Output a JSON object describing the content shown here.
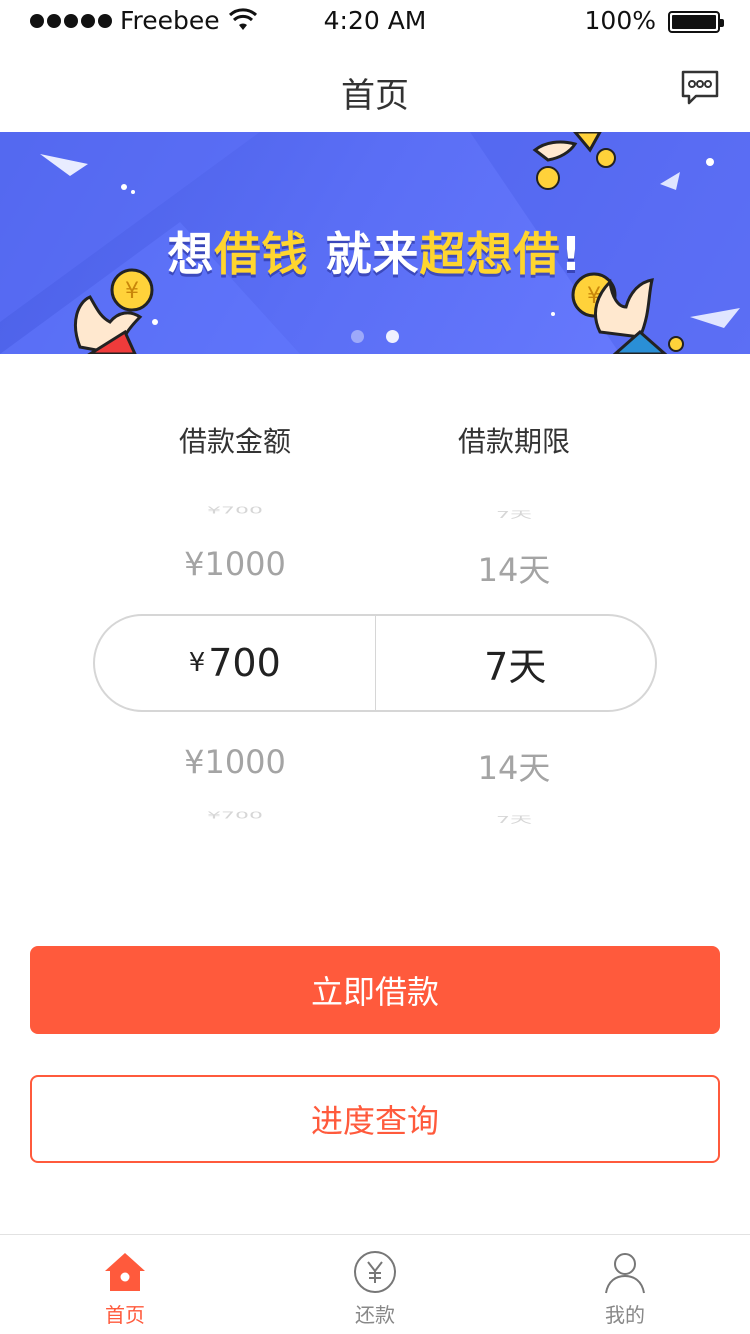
{
  "status_bar": {
    "carrier": "Freebee",
    "time": "4:20 AM",
    "battery": "100%"
  },
  "nav": {
    "title": "首页",
    "right_icon": "chat-bubble-icon"
  },
  "banner": {
    "headline_parts": [
      "想",
      "借钱",
      " 就来",
      "超想借",
      "!"
    ],
    "page_dots": 2,
    "active_dot": 1,
    "colors": {
      "bg": "#5a6ef5",
      "highlight": "#ffd52e"
    }
  },
  "picker": {
    "amount_header": "借款金额",
    "term_header": "借款期限",
    "amount_options": [
      "¥700",
      "¥1000"
    ],
    "term_options": [
      "7天",
      "14天"
    ],
    "selected_amount_symbol": "¥",
    "selected_amount_value": "700",
    "selected_term": "7天"
  },
  "actions": {
    "primary_label": "立即借款",
    "secondary_label": "进度查询"
  },
  "tabs": [
    {
      "label": "首页",
      "icon": "home-icon",
      "active": true
    },
    {
      "label": "还款",
      "icon": "yen-circle-icon",
      "active": false
    },
    {
      "label": "我的",
      "icon": "user-icon",
      "active": false
    }
  ],
  "colors": {
    "accent": "#ff5a3c",
    "tab_inactive": "#888888"
  }
}
